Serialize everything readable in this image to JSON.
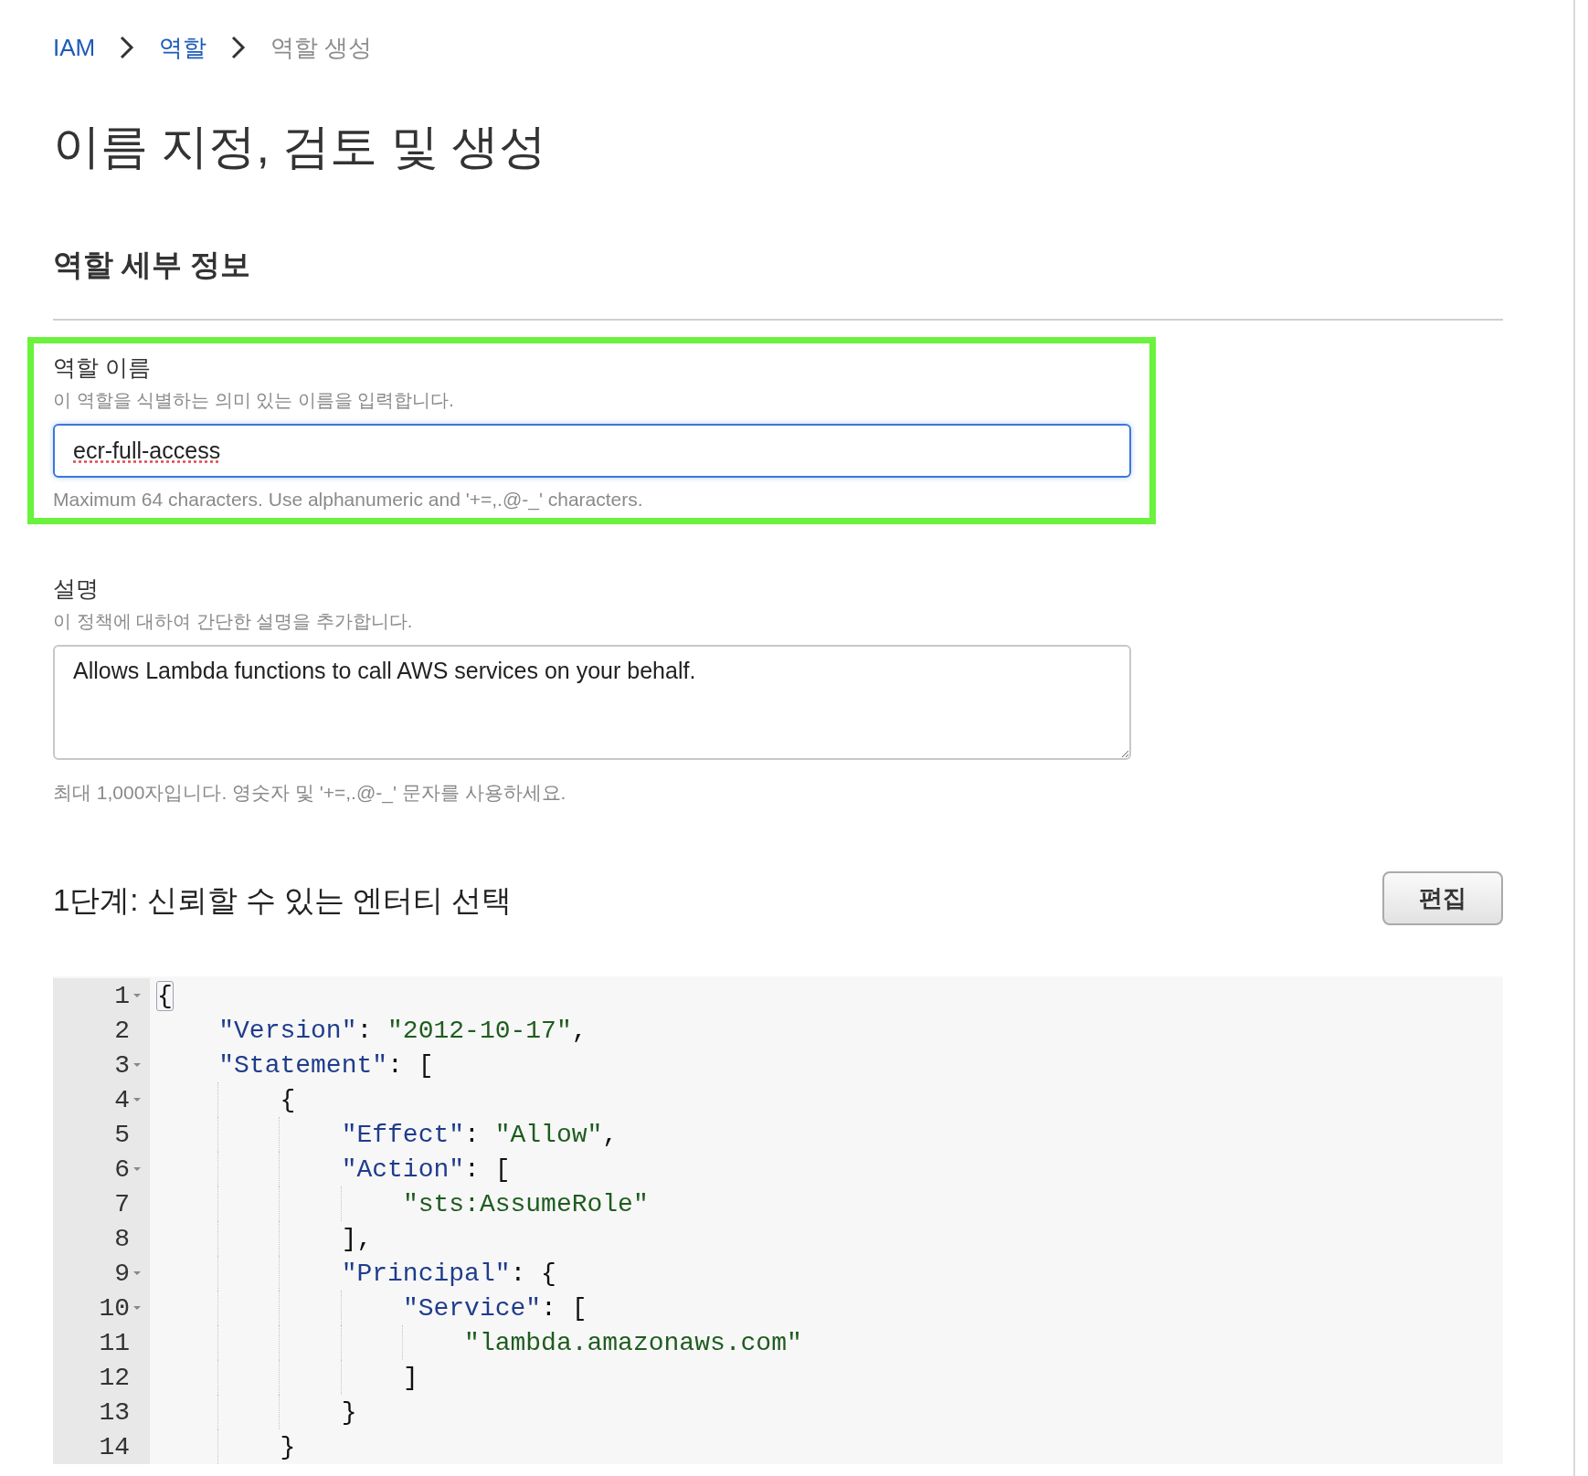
{
  "breadcrumb": [
    {
      "label": "IAM",
      "kind": "link"
    },
    {
      "label": "역할",
      "kind": "link"
    },
    {
      "label": "역할 생성",
      "kind": "current"
    }
  ],
  "title": "이름 지정, 검토 및 생성",
  "section": {
    "heading": "역할 세부 정보"
  },
  "role_name": {
    "label": "역할 이름",
    "hint": "이 역할을 식별하는 의미 있는 이름을 입력합니다.",
    "value": "ecr-full-access",
    "help": "Maximum 64 characters. Use alphanumeric and '+=,.@-_' characters.",
    "highlighted": true,
    "focused": true
  },
  "description": {
    "label": "설명",
    "hint": "이 정책에 대하여 간단한 설명을 추가합니다.",
    "value": "Allows Lambda functions to call AWS services on your behalf.",
    "help": "최대 1,000자입니다. 영숫자 및 '+=,.@-_' 문자를 사용하세요."
  },
  "step": {
    "heading": "1단계: 신뢰할 수 있는 엔터티 선택",
    "button": "편집"
  },
  "code_lines": [
    {
      "number": "1",
      "foldable": true,
      "tokens": [
        {
          "kind": "matched",
          "text": "{"
        }
      ]
    },
    {
      "number": "2",
      "foldable": false,
      "tokens": [
        {
          "kind": "key",
          "text": "    \"Version\""
        },
        {
          "kind": "punct",
          "text": ": "
        },
        {
          "kind": "string",
          "text": "\"2012-10-17\""
        },
        {
          "kind": "punct",
          "text": ","
        }
      ]
    },
    {
      "number": "3",
      "foldable": true,
      "tokens": [
        {
          "kind": "key",
          "text": "    \"Statement\""
        },
        {
          "kind": "punct",
          "text": ": ["
        }
      ]
    },
    {
      "number": "4",
      "foldable": true,
      "tokens": [
        {
          "kind": "punct",
          "text": "        {"
        }
      ]
    },
    {
      "number": "5",
      "foldable": false,
      "tokens": [
        {
          "kind": "key",
          "text": "            \"Effect\""
        },
        {
          "kind": "punct",
          "text": ": "
        },
        {
          "kind": "string",
          "text": "\"Allow\""
        },
        {
          "kind": "punct",
          "text": ","
        }
      ]
    },
    {
      "number": "6",
      "foldable": true,
      "tokens": [
        {
          "kind": "key",
          "text": "            \"Action\""
        },
        {
          "kind": "punct",
          "text": ": ["
        }
      ]
    },
    {
      "number": "7",
      "foldable": false,
      "tokens": [
        {
          "kind": "string",
          "text": "                \"sts:AssumeRole\""
        }
      ]
    },
    {
      "number": "8",
      "foldable": false,
      "tokens": [
        {
          "kind": "punct",
          "text": "            ],"
        }
      ]
    },
    {
      "number": "9",
      "foldable": true,
      "tokens": [
        {
          "kind": "key",
          "text": "            \"Principal\""
        },
        {
          "kind": "punct",
          "text": ": {"
        }
      ]
    },
    {
      "number": "10",
      "foldable": true,
      "tokens": [
        {
          "kind": "key",
          "text": "                \"Service\""
        },
        {
          "kind": "punct",
          "text": ": ["
        }
      ]
    },
    {
      "number": "11",
      "foldable": false,
      "tokens": [
        {
          "kind": "string",
          "text": "                    \"lambda.amazonaws.com\""
        }
      ]
    },
    {
      "number": "12",
      "foldable": false,
      "tokens": [
        {
          "kind": "punct",
          "text": "                ]"
        }
      ]
    },
    {
      "number": "13",
      "foldable": false,
      "tokens": [
        {
          "kind": "punct",
          "text": "            }"
        }
      ]
    },
    {
      "number": "14",
      "foldable": false,
      "tokens": [
        {
          "kind": "punct",
          "text": "        }"
        }
      ]
    }
  ]
}
